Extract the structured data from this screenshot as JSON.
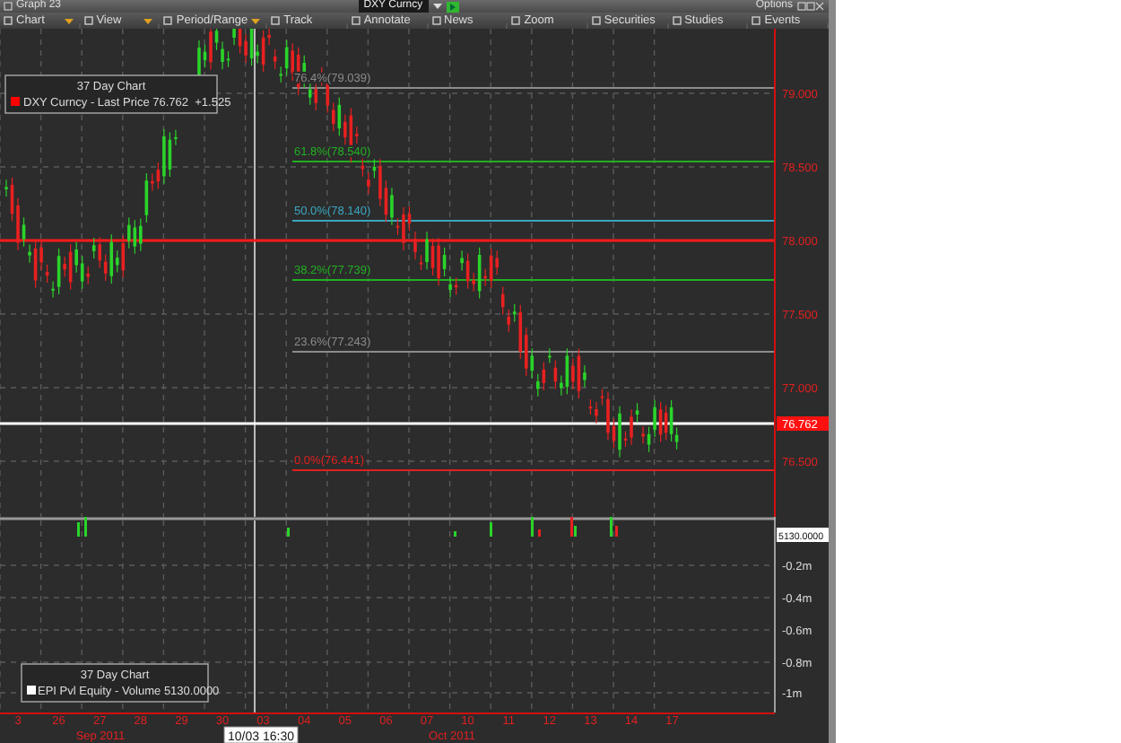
{
  "window": {
    "title": "Graph 23",
    "security": "DXY Curncy",
    "menu": "Options"
  },
  "toolbar": [
    {
      "label": "Chart",
      "dropdown": true
    },
    {
      "label": "View",
      "dropdown": true
    },
    {
      "label": "Period/Range",
      "dropdown": true
    },
    {
      "label": "Track",
      "dropdown": false
    },
    {
      "label": "Annotate",
      "dropdown": false
    },
    {
      "label": "News",
      "dropdown": false
    },
    {
      "label": "Zoom",
      "dropdown": false
    },
    {
      "label": "Securities",
      "dropdown": false
    },
    {
      "label": "Studies",
      "dropdown": false
    },
    {
      "label": "Events",
      "dropdown": false
    }
  ],
  "price_panel": {
    "legend": {
      "title": "37 Day Chart",
      "text": "DXY Curncy - Last Price 76.762  +1.525",
      "color": "#ff0000"
    },
    "retracements": [
      {
        "label": "76.4%(79.039)",
        "color": "#8c8c8c"
      },
      {
        "label": "61.8%(78.540)",
        "color": "#22b022"
      },
      {
        "label": "50.0%(78.140)",
        "color": "#3aa6c0"
      },
      {
        "label": "38.2%(77.739)",
        "color": "#22b022"
      },
      {
        "label": "23.6%(77.243)",
        "color": "#8c8c8c"
      },
      {
        "label": "0.0%(76.441)",
        "color": "#e02020"
      }
    ],
    "axis_labels": [
      "79.000",
      "78.500",
      "78.000",
      "77.500",
      "77.000",
      "76.500"
    ],
    "last_price_tag": "76.762"
  },
  "volume_panel": {
    "legend": {
      "title": "37 Day Chart",
      "text": "EPI Pvl Equity - Volume 5130.0000",
      "color": "#ffffff"
    },
    "value_tag": "5130.0000",
    "axis_labels": [
      "-0.2m",
      "-0.4m",
      "-0.6m",
      "-0.8m",
      "-1m"
    ]
  },
  "x_axis": {
    "dates": [
      "3",
      "26",
      "27",
      "28",
      "29",
      "30",
      "03",
      "04",
      "05",
      "06",
      "07",
      "10",
      "11",
      "12",
      "13",
      "14",
      "17"
    ],
    "months": [
      "Sep 2011",
      "Oct 2011"
    ]
  },
  "cursor": {
    "label": "10/03 16:30"
  }
}
